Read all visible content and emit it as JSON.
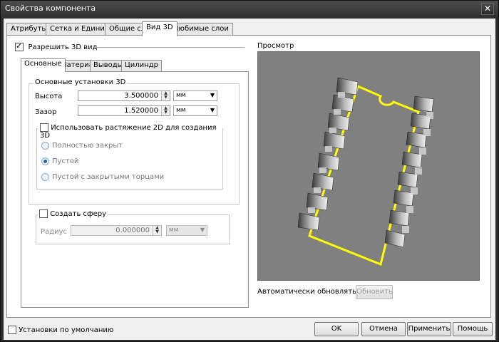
{
  "window": {
    "title": "Свойства компонента",
    "close_glyph": "✕"
  },
  "tabs": [
    {
      "label": "Атрибуты",
      "active": false
    },
    {
      "label": "Сетка и Единицы",
      "active": false
    },
    {
      "label": "Общие слои",
      "active": false
    },
    {
      "label": "Вид 3D",
      "active": true
    },
    {
      "label": "Любимые слои",
      "active": false
    }
  ],
  "enable3d": {
    "label": "Разрешить 3D вид",
    "checked": true
  },
  "preview": {
    "label": "Просмотр",
    "background": "#808080",
    "outline_color": "#ffff00"
  },
  "subtabs": [
    {
      "label": "Основные",
      "active": true
    },
    {
      "label": "Материал",
      "active": false
    },
    {
      "label": "Выводы",
      "active": false
    },
    {
      "label": "Цилиндр",
      "active": false
    }
  ],
  "basic": {
    "title": "Основные установки 3D",
    "height": {
      "label": "Высота",
      "value": "3.500000",
      "unit": "мм"
    },
    "gap": {
      "label": "Зазор",
      "value": "1.520000",
      "unit": "мм"
    }
  },
  "extrude": {
    "label": "Использовать растяжение 2D для создания 3D",
    "checked": false,
    "options": [
      "Полностью закрыт",
      "Пустой",
      "Пустой с закрытыми торцами"
    ],
    "selected_index": 1
  },
  "sphere": {
    "label": "Создать сферу",
    "checked": false,
    "radius": {
      "label": "Радиус",
      "value": "0.000000",
      "unit": "мм"
    }
  },
  "autoupdate": {
    "label": "Автоматически обновлять",
    "checked": true,
    "button": "Обновить"
  },
  "defaults": {
    "label": "Установки по умолчанию",
    "checked": false
  },
  "buttons": {
    "ok": "OK",
    "cancel": "Отмена",
    "apply": "Применить",
    "help": "Помощь"
  },
  "icons": {
    "check": "check-icon",
    "spin_up": "arrow-up-icon",
    "spin_down": "arrow-down-icon",
    "dropdown": "chevron-down-icon"
  }
}
